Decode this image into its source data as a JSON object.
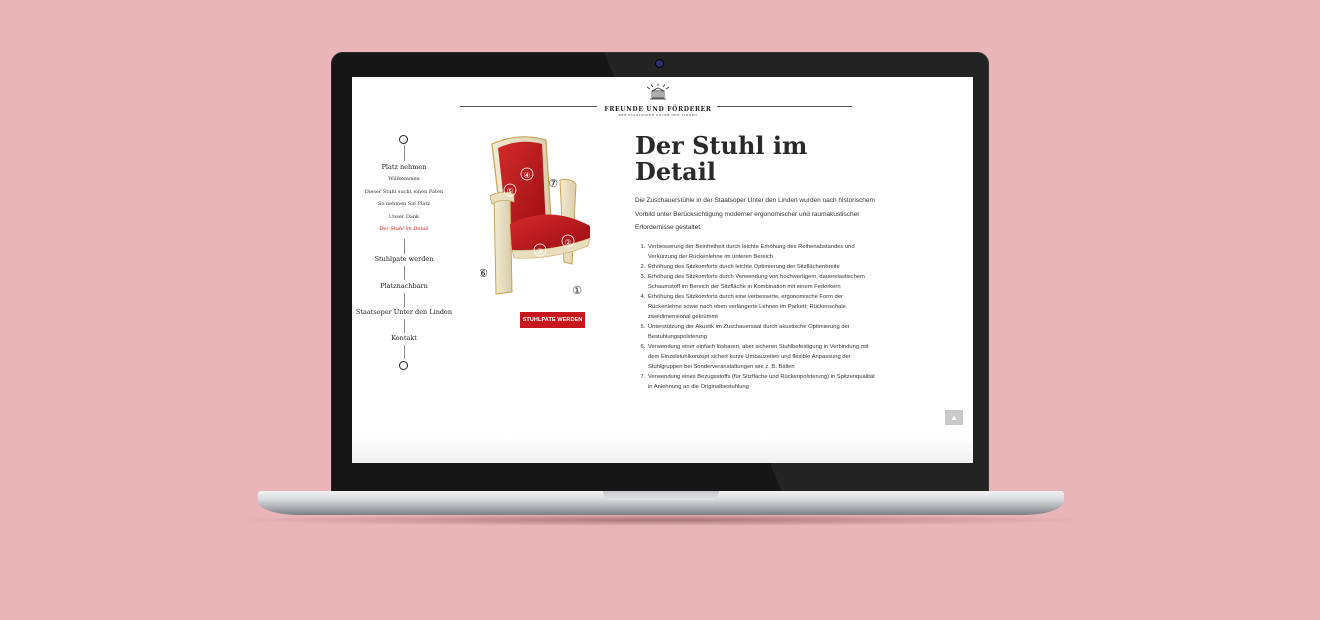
{
  "colors": {
    "background": "#e9b5b8",
    "accent": "#c8161d",
    "active_link": "#c81a1a"
  },
  "logo": {
    "title": "FREUNDE UND FÖRDERER",
    "subtitle": "DER STAATSOPER UNTER DEN LINDEN",
    "icon": "opera-house-icon"
  },
  "nav": {
    "section1": "Platz nehmen",
    "subitems": [
      "Willkommen",
      "Dieser Stuhl sucht einen Paten",
      "So nehmen Sie Platz",
      "Unser Dank",
      "Der Stuhl im Detail"
    ],
    "active_subitem": "Der Stuhl im Detail",
    "section2": "Stuhlpate werden",
    "section3": "Platznachbarn",
    "section4": "Staatsoper Unter den Linden",
    "section5": "Kontakt"
  },
  "chair": {
    "markers": [
      "①",
      "②",
      "③",
      "④",
      "⑤",
      "⑥",
      "⑦"
    ],
    "cta_label": "STUHLPATE WERDEN"
  },
  "article": {
    "title": "Der Stuhl im Detail",
    "intro": "Die Zuschauerstühle in der Staatsoper Unter den Linden wurden nach historischem Vorbild unter Berücksichtigung moderner ergonomischer und raumakustischer Erfordernisse gestaltet.",
    "points": [
      "Verbesserung der Beinfreiheit durch leichte Erhöhung des Reihenabstandes und Verkürzung der Rückenlehne im unteren Bereich",
      "Erhöhung des Sitzkomforts durch leichte Optimierung der Sitzflächenbreite",
      "Erhöhung des Sitzkomforts durch Verwendung von hochwertigem, dauerelastischem Schaumstoff im Bereich der Sitzfläche in Kombination mit einem Federkern",
      "Erhöhung des Sitzkomforts durch eine verbesserte, ergonomische Form der Rückenlehne sowie nach oben verlängerte Lehnen im Parkett; Rückenschale zweidimensional gekrümmt",
      "Unterstützung der Akustik im Zuschauersaal durch akustische Optimierung der Bestuhlungspolsterung",
      "Verwendung einer einfach lösbaren, aber sicheren Stuhlbefestigung in Verbindung mit dem Einzelstuhlkonzept sichert kurze Umbauzeiten und flexible Anpassung der Stuhlgruppen bei Sonderveranstaltungen wie z. B. Bällen",
      "Verwendung eines Bezugsstoffs (für Sitzfläche und Rückenpolsterung) in Spitzenqualität in Anlehnung an die Originalbestuhlung"
    ]
  },
  "to_top_icon": "arrow-up-icon"
}
